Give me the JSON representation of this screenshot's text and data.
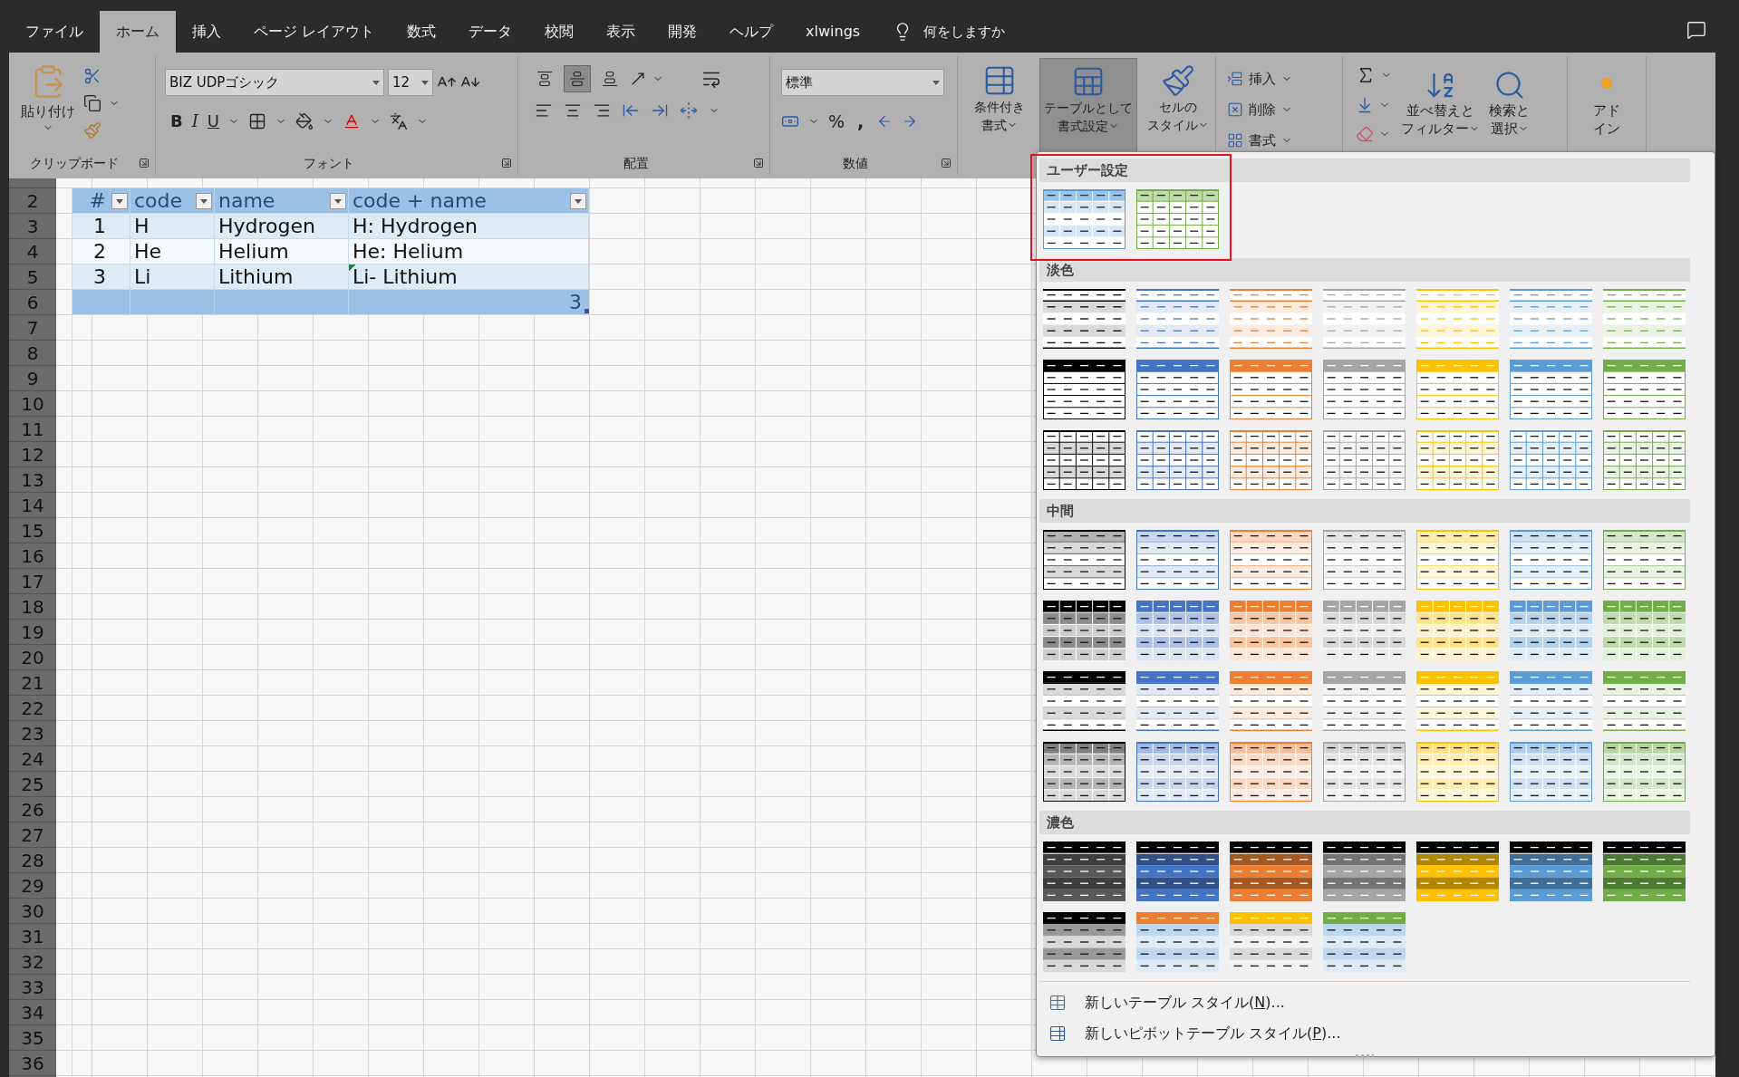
{
  "tabs": [
    {
      "label": "ファイル",
      "selected": false
    },
    {
      "label": "ホーム",
      "selected": true
    },
    {
      "label": "挿入",
      "selected": false
    },
    {
      "label": "ページ レイアウト",
      "selected": false
    },
    {
      "label": "数式",
      "selected": false
    },
    {
      "label": "データ",
      "selected": false
    },
    {
      "label": "校閲",
      "selected": false
    },
    {
      "label": "表示",
      "selected": false
    },
    {
      "label": "開発",
      "selected": false
    },
    {
      "label": "ヘルプ",
      "selected": false
    },
    {
      "label": "xlwings",
      "selected": false
    }
  ],
  "tell_me": "何をしますか",
  "ribbon": {
    "clipboard": {
      "paste": "貼り付け",
      "label": "クリップボード"
    },
    "font": {
      "name": "BIZ UDPゴシック",
      "size": "12",
      "bold": "B",
      "italic": "I",
      "underline": "U",
      "label": "フォント"
    },
    "alignment": {
      "label": "配置",
      "vertical": [
        {
          "pressed": false
        },
        {
          "pressed": true
        },
        {
          "pressed": false
        }
      ]
    },
    "number": {
      "format": "標準",
      "percent": "%",
      "comma": ",",
      "label": "数値"
    },
    "styles": [
      {
        "lines": [
          "条件付き",
          "書式"
        ],
        "pressed": false
      },
      {
        "lines": [
          "テーブルとして",
          "書式設定"
        ],
        "pressed": true
      },
      {
        "lines": [
          "セルの",
          "スタイル"
        ],
        "pressed": false
      }
    ],
    "cells": [
      "挿入",
      "削除",
      "書式"
    ],
    "editing": [
      {
        "lines": [
          "並べ替えと",
          "フィルター"
        ]
      },
      {
        "lines": [
          "検索と",
          "選択"
        ]
      }
    ],
    "addins": [
      "アド",
      "イン"
    ]
  },
  "sheet": {
    "row_numbers": [
      "2",
      "3",
      "4",
      "5",
      "6",
      "7",
      "8",
      "9",
      "10",
      "11",
      "12",
      "13",
      "14",
      "15",
      "16",
      "17",
      "18",
      "19",
      "20",
      "21",
      "22",
      "23",
      "24",
      "25",
      "26",
      "27",
      "28",
      "29",
      "30",
      "31",
      "32",
      "33",
      "34",
      "35",
      "36"
    ],
    "table": {
      "columns": [
        "#",
        "code",
        "name",
        "code + name"
      ],
      "rows": [
        {
          "cells": [
            "1",
            "H",
            "Hydrogen",
            "H: Hydrogen"
          ],
          "flagged": false
        },
        {
          "cells": [
            "2",
            "He",
            "Helium",
            "He: Helium"
          ],
          "flagged": false
        },
        {
          "cells": [
            "3",
            "Li",
            "Lithium",
            "Li- Lithium"
          ],
          "flagged": true
        }
      ],
      "total": "3"
    }
  },
  "gallery": {
    "sections": [
      {
        "title": "ユーザー設定",
        "annotated": true,
        "styles": [
          {
            "kind": "custom-banded",
            "color": "#5b9bd5"
          },
          {
            "kind": "custom-grid",
            "color": "#70ad47"
          }
        ]
      },
      {
        "title": "淡色",
        "annotated": false,
        "styles": [
          {
            "kind": "light-lines",
            "color": "#000000"
          },
          {
            "kind": "light-lines",
            "color": "#4472c4"
          },
          {
            "kind": "light-lines",
            "color": "#ed7d31"
          },
          {
            "kind": "light-lines",
            "color": "#a5a5a5"
          },
          {
            "kind": "light-lines",
            "color": "#ffc000"
          },
          {
            "kind": "light-lines",
            "color": "#5b9bd5"
          },
          {
            "kind": "light-lines",
            "color": "#70ad47"
          },
          {
            "kind": "light-header",
            "color": "#000000"
          },
          {
            "kind": "light-header",
            "color": "#4472c4"
          },
          {
            "kind": "light-header",
            "color": "#ed7d31"
          },
          {
            "kind": "light-header",
            "color": "#a5a5a5"
          },
          {
            "kind": "light-header",
            "color": "#ffc000"
          },
          {
            "kind": "light-header",
            "color": "#5b9bd5"
          },
          {
            "kind": "light-header",
            "color": "#70ad47"
          },
          {
            "kind": "light-grid",
            "color": "#000000"
          },
          {
            "kind": "light-grid",
            "color": "#4472c4"
          },
          {
            "kind": "light-grid",
            "color": "#ed7d31"
          },
          {
            "kind": "light-grid",
            "color": "#a5a5a5"
          },
          {
            "kind": "light-grid",
            "color": "#ffc000"
          },
          {
            "kind": "light-grid",
            "color": "#5b9bd5"
          },
          {
            "kind": "light-grid",
            "color": "#70ad47"
          }
        ]
      },
      {
        "title": "中間",
        "annotated": false,
        "styles": [
          {
            "kind": "medium-banded",
            "color": "#000000"
          },
          {
            "kind": "medium-banded",
            "color": "#4472c4"
          },
          {
            "kind": "medium-banded",
            "color": "#ed7d31"
          },
          {
            "kind": "medium-banded",
            "color": "#a5a5a5"
          },
          {
            "kind": "medium-banded",
            "color": "#ffc000"
          },
          {
            "kind": "medium-banded",
            "color": "#5b9bd5"
          },
          {
            "kind": "medium-banded",
            "color": "#70ad47"
          },
          {
            "kind": "medium-header-grid",
            "color": "#000000"
          },
          {
            "kind": "medium-header-grid",
            "color": "#4472c4"
          },
          {
            "kind": "medium-header-grid",
            "color": "#ed7d31"
          },
          {
            "kind": "medium-header-grid",
            "color": "#a5a5a5"
          },
          {
            "kind": "medium-header-grid",
            "color": "#ffc000"
          },
          {
            "kind": "medium-header-grid",
            "color": "#5b9bd5"
          },
          {
            "kind": "medium-header-grid",
            "color": "#70ad47"
          },
          {
            "kind": "medium-header",
            "color": "#000000"
          },
          {
            "kind": "medium-header",
            "color": "#4472c4"
          },
          {
            "kind": "medium-header",
            "color": "#ed7d31"
          },
          {
            "kind": "medium-header",
            "color": "#a5a5a5"
          },
          {
            "kind": "medium-header",
            "color": "#ffc000"
          },
          {
            "kind": "medium-header",
            "color": "#5b9bd5"
          },
          {
            "kind": "medium-header",
            "color": "#70ad47"
          },
          {
            "kind": "medium-grid",
            "color": "#000000"
          },
          {
            "kind": "medium-grid",
            "color": "#4472c4"
          },
          {
            "kind": "medium-grid",
            "color": "#ed7d31"
          },
          {
            "kind": "medium-grid",
            "color": "#a5a5a5"
          },
          {
            "kind": "medium-grid",
            "color": "#ffc000"
          },
          {
            "kind": "medium-grid",
            "color": "#5b9bd5"
          },
          {
            "kind": "medium-grid",
            "color": "#70ad47"
          }
        ]
      },
      {
        "title": "濃色",
        "annotated": false,
        "styles": [
          {
            "kind": "dark-banded",
            "color": "#000000"
          },
          {
            "kind": "dark-banded",
            "color": "#4472c4"
          },
          {
            "kind": "dark-banded",
            "color": "#ed7d31"
          },
          {
            "kind": "dark-banded",
            "color": "#a5a5a5"
          },
          {
            "kind": "dark-banded",
            "color": "#ffc000"
          },
          {
            "kind": "dark-banded",
            "color": "#5b9bd5"
          },
          {
            "kind": "dark-banded",
            "color": "#70ad47"
          },
          {
            "kind": "dark-header",
            "color": "#000000"
          },
          {
            "kind": "dark-header-blue-bands",
            "color": "#ed7d31"
          },
          {
            "kind": "dark-header-grey-bands",
            "color": "#ffc000"
          },
          {
            "kind": "dark-header-blue-bands",
            "color": "#70ad47"
          }
        ]
      }
    ],
    "footer": [
      {
        "before": "新しいテーブル スタイル(",
        "key": "N",
        "after": ")..."
      },
      {
        "before": "新しいピボットテーブル スタイル(",
        "key": "P",
        "after": ")..."
      }
    ]
  }
}
